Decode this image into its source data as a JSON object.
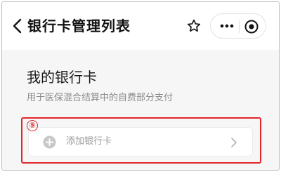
{
  "navbar": {
    "title": "银行卡管理列表",
    "back_icon": "chevron-left-icon",
    "star_icon": "star-outline-icon",
    "more_icon": "more-horizontal-icon",
    "record_icon": "target-icon"
  },
  "section": {
    "title": "我的银行卡",
    "subtitle": "用于医保混合结算中的自费部分支付"
  },
  "annotation": {
    "step_number": "⑤",
    "highlight_color": "#e0262b"
  },
  "add_card": {
    "label": "添加银行卡",
    "icon": "plus-circle-icon",
    "arrow_icon": "chevron-right-icon"
  }
}
